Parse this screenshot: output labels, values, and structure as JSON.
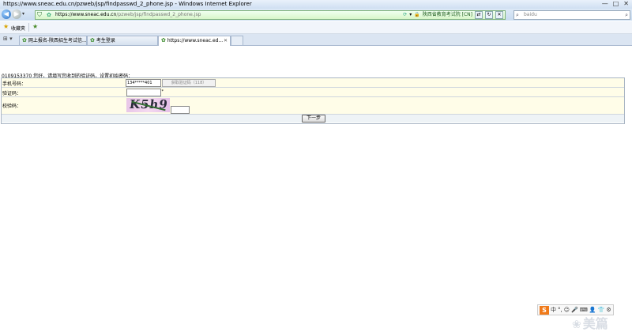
{
  "window": {
    "title": "https://www.sneac.edu.cn/pzweb/jsp/findpasswd_2_phone.jsp - Windows Internet Explorer",
    "controls": [
      "—",
      "□",
      "✕"
    ]
  },
  "address_bar": {
    "url_host": "https://www.sneac.edu.cn",
    "url_path": "/pzweb/jsp/findpasswd_2_phone.jsp",
    "cert_label": "陕西省教育考试院 [CN]",
    "search_placeholder": "baidu"
  },
  "favorites_bar": {
    "favorites_label": "收藏夹"
  },
  "tabs": [
    {
      "label": "网上报名-陕西招生考试信..."
    },
    {
      "label": "考生登录"
    },
    {
      "label": "https://www.sneac.ed...",
      "active": true
    },
    {
      "label": ""
    }
  ],
  "form": {
    "intro_text": "0109153370 您好，请填写您收到的验证码，设置初始密码：",
    "phone_label": "手机号码：",
    "phone_value": "134*****401",
    "get_code_button": "获取验证码（118）",
    "code_label": "验证码：",
    "captcha_label": "校验码：",
    "captcha_text": "K5h9",
    "next_button": "下一步"
  },
  "watermark": {
    "text": "美篇"
  },
  "ime_toolbar": {
    "logo": "S",
    "items": [
      "中",
      "°,",
      "☺",
      "🎤",
      "⌨",
      "👤",
      "👕",
      "⚙"
    ]
  }
}
